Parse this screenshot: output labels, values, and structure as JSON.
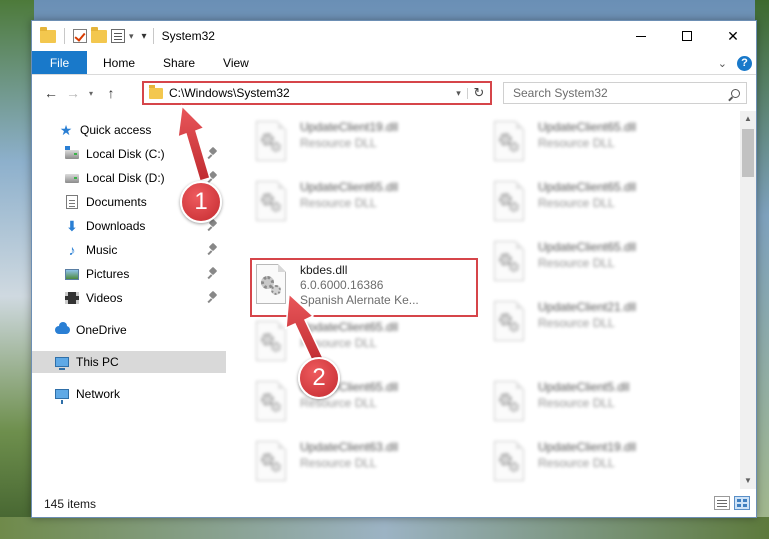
{
  "window": {
    "title": "System32",
    "controls": {
      "minimize": "—",
      "maximize": "☐",
      "close": "✕"
    }
  },
  "ribbon": {
    "tabs": [
      "File",
      "Home",
      "Share",
      "View"
    ],
    "help": "?"
  },
  "navigation": {
    "back": "←",
    "forward": "→",
    "recent": "▾",
    "up": "↑",
    "address_path": "C:\\Windows\\System32",
    "address_dropdown": "▾",
    "refresh": "↻",
    "search_placeholder": "Search System32"
  },
  "sidebar": {
    "items": [
      {
        "label": "Quick access",
        "icon": "star-icon",
        "pinned": false
      },
      {
        "label": "Local Disk (C:)",
        "icon": "local-disk-icon",
        "pinned": true
      },
      {
        "label": "Local Disk (D:)",
        "icon": "local-disk-icon",
        "pinned": true
      },
      {
        "label": "Documents",
        "icon": "documents-icon",
        "pinned": true
      },
      {
        "label": "Downloads",
        "icon": "downloads-icon",
        "pinned": true
      },
      {
        "label": "Music",
        "icon": "music-icon",
        "pinned": true
      },
      {
        "label": "Pictures",
        "icon": "pictures-icon",
        "pinned": true
      },
      {
        "label": "Videos",
        "icon": "videos-icon",
        "pinned": true
      },
      {
        "label": "OneDrive",
        "icon": "onedrive-icon",
        "pinned": false
      },
      {
        "label": "This PC",
        "icon": "this-pc-icon",
        "pinned": false,
        "selected": true
      },
      {
        "label": "Network",
        "icon": "network-icon",
        "pinned": false
      }
    ]
  },
  "files": {
    "left_column": [
      {
        "name": "UpdateClient19.dll",
        "desc": "Resource DLL",
        "blurred": true
      },
      {
        "name": "UpdateClient65.dll",
        "desc": "Resource DLL",
        "blurred": true
      },
      {
        "name": "kbdes.dll",
        "version": "6.0.6000.16386",
        "desc": "Spanish Alernate Ke...",
        "blurred": false,
        "highlighted": true
      },
      {
        "name": "UpdateClient65.dll",
        "desc": "Resource DLL",
        "blurred": true
      },
      {
        "name": "UpdateClient65.dll",
        "desc": "Resource DLL",
        "blurred": true
      },
      {
        "name": "UpdateClient63.dll",
        "desc": "Resource DLL",
        "blurred": true
      }
    ],
    "right_column": [
      {
        "name": "UpdateClient65.dll",
        "desc": "Resource DLL",
        "blurred": true
      },
      {
        "name": "UpdateClient65.dll",
        "desc": "Resource DLL",
        "blurred": true
      },
      {
        "name": "UpdateClient65.dll",
        "desc": "Resource DLL",
        "blurred": true
      },
      {
        "name": "UpdateClient21.dll",
        "desc": "Resource DLL",
        "blurred": true
      },
      {
        "name": "UpdateClient5.dll",
        "desc": "Resource DLL",
        "blurred": true
      },
      {
        "name": "UpdateClient19.dll",
        "desc": "Resource DLL",
        "blurred": true
      }
    ]
  },
  "status": {
    "item_count": "145 items"
  },
  "annotations": {
    "step1": "1",
    "step2": "2",
    "color": "#d6454a"
  },
  "colors": {
    "accent": "#1979ca",
    "highlight": "#d6454a",
    "selected_nav": "#d9d9d9"
  }
}
